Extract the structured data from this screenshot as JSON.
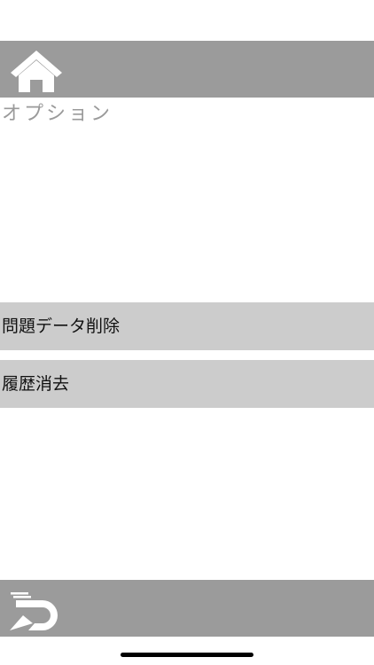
{
  "header": {
    "home_icon": "home-icon"
  },
  "page": {
    "title": "オプション"
  },
  "menu": {
    "items": [
      {
        "label": "問題データ削除"
      },
      {
        "label": "履歴消去"
      }
    ]
  },
  "footer": {
    "back_icon": "back-return-icon"
  },
  "colors": {
    "bar": "#9b9b9b",
    "menu_item_bg": "#cccccc",
    "title_text": "#9a9a9a",
    "icon": "#ffffff"
  }
}
